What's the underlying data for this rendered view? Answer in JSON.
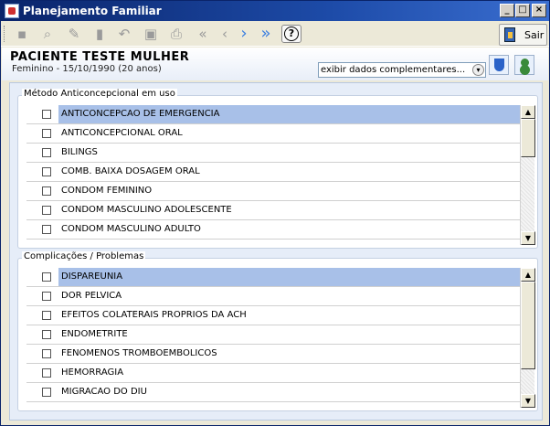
{
  "window": {
    "title": "Planejamento Familiar",
    "min_glyph": "_",
    "max_glyph": "□",
    "close_glyph": "×"
  },
  "toolbar": {
    "icons": [
      "new-icon",
      "search-icon",
      "edit-icon",
      "delete-icon",
      "undo-icon",
      "save-icon",
      "print-icon",
      "first-record-icon",
      "previous-record-icon",
      "next-record-icon",
      "last-record-icon",
      "help-icon"
    ],
    "help_glyph": "?",
    "exit_label": "Sair",
    "glyphs": {
      "new": "▪",
      "search": "⌕",
      "edit": "✎",
      "delete": "▮",
      "undo": "↶",
      "save": "▣",
      "print": "⎙",
      "first": "«",
      "previous": "‹",
      "next": "›",
      "last": "»"
    }
  },
  "patient": {
    "name": "PACIENTE TESTE MULHER",
    "details": "Feminino - 15/10/1990 (20 anos)"
  },
  "extra_data_select": {
    "value": "exibir dados complementares...",
    "dd_glyph": "▾"
  },
  "methods": {
    "legend": "Método Anticoncepcional em uso",
    "items": [
      {
        "label": "ANTICONCEPCAO DE EMERGENCIA",
        "checked": false,
        "selected": true
      },
      {
        "label": "ANTICONCEPCIONAL ORAL",
        "checked": false,
        "selected": false
      },
      {
        "label": "BILINGS",
        "checked": false,
        "selected": false
      },
      {
        "label": "COMB. BAIXA DOSAGEM ORAL",
        "checked": false,
        "selected": false
      },
      {
        "label": "CONDOM FEMININO",
        "checked": false,
        "selected": false
      },
      {
        "label": "CONDOM MASCULINO ADOLESCENTE",
        "checked": false,
        "selected": false
      },
      {
        "label": "CONDOM MASCULINO ADULTO",
        "checked": false,
        "selected": false
      }
    ]
  },
  "complications": {
    "legend": "Complicações / Problemas",
    "items": [
      {
        "label": "DISPAREUNIA",
        "checked": false,
        "selected": true
      },
      {
        "label": "DOR PELVICA",
        "checked": false,
        "selected": false
      },
      {
        "label": "EFEITOS COLATERAIS PROPRIOS DA ACH",
        "checked": false,
        "selected": false
      },
      {
        "label": "ENDOMETRITE",
        "checked": false,
        "selected": false
      },
      {
        "label": "FENOMENOS TROMBOEMBOLICOS",
        "checked": false,
        "selected": false
      },
      {
        "label": "HEMORRAGIA",
        "checked": false,
        "selected": false
      },
      {
        "label": "MIGRACAO DO DIU",
        "checked": false,
        "selected": false
      }
    ]
  },
  "scroll": {
    "up_glyph": "▲",
    "down_glyph": "▼"
  }
}
